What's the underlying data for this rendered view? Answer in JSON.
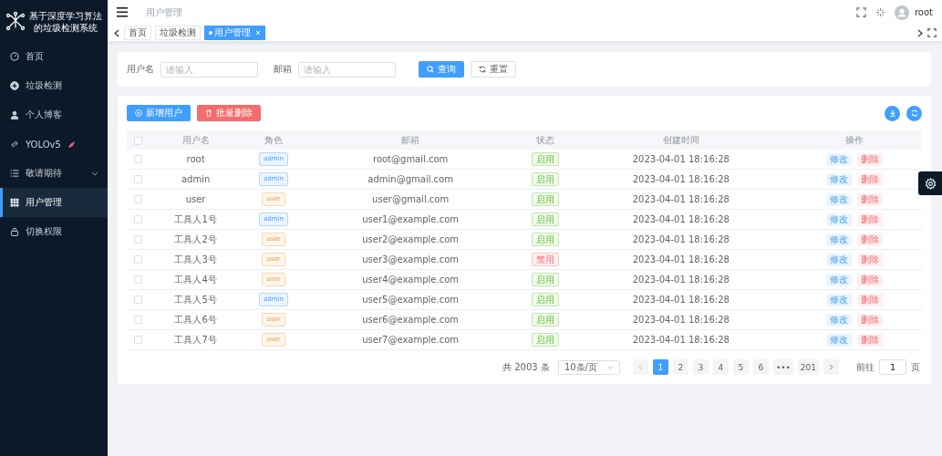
{
  "sidebar": {
    "title_lines": [
      "基于深度学习算法",
      "的垃圾检测系统"
    ],
    "items": [
      {
        "label": "首页",
        "selected": false
      },
      {
        "label": "垃圾检测",
        "selected": false
      },
      {
        "label": "个人博客",
        "selected": false
      },
      {
        "label": "YOLOv5",
        "selected": false
      },
      {
        "label": "敬请期待",
        "selected": false,
        "expanded": false
      },
      {
        "label": "用户管理",
        "selected": true
      },
      {
        "label": "切换权限",
        "selected": false
      }
    ]
  },
  "header": {
    "breadcrumb": "用户管理",
    "user": "root"
  },
  "tabs": [
    {
      "label": "首页",
      "selected": false,
      "closable": false
    },
    {
      "label": "垃圾检测",
      "selected": false,
      "closable": false
    },
    {
      "label": "用户管理",
      "selected": true,
      "closable": true
    }
  ],
  "search": {
    "fields": [
      {
        "label": "用户名",
        "placeholder": "请输入"
      },
      {
        "label": "邮箱",
        "placeholder": "请输入"
      }
    ],
    "query_button": "查询",
    "reset_button": "重置"
  },
  "toolbar": {
    "add_button": "新增用户",
    "batch_delete_button": "批量删除"
  },
  "table": {
    "select_all_checked": false,
    "columns": [
      "用户名",
      "角色",
      "邮箱",
      "状态",
      "创建时间",
      "操作"
    ],
    "rows": [
      {
        "username": "root",
        "role": {
          "label": "admin",
          "kind": "primary"
        },
        "email": "root@gmail.com",
        "status": {
          "label": "启用",
          "enabled": true
        },
        "created": "2023-04-01 18:16:28",
        "edit": "修改",
        "delete": "删除",
        "checked": false
      },
      {
        "username": "admin",
        "role": {
          "label": "admin",
          "kind": "primary"
        },
        "email": "admin@gmail.com",
        "status": {
          "label": "启用",
          "enabled": true
        },
        "created": "2023-04-01 18:16:28",
        "edit": "修改",
        "delete": "删除",
        "checked": false
      },
      {
        "username": "user",
        "role": {
          "label": "user",
          "kind": "warning"
        },
        "email": "user@gmail.com",
        "status": {
          "label": "启用",
          "enabled": true
        },
        "created": "2023-04-01 18:16:28",
        "edit": "修改",
        "delete": "删除",
        "checked": false
      },
      {
        "username": "工具人1号",
        "role": {
          "label": "admin",
          "kind": "primary"
        },
        "email": "user1@example.com",
        "status": {
          "label": "启用",
          "enabled": true
        },
        "created": "2023-04-01 18:16:28",
        "edit": "修改",
        "delete": "删除",
        "checked": false
      },
      {
        "username": "工具人2号",
        "role": {
          "label": "user",
          "kind": "warning"
        },
        "email": "user2@example.com",
        "status": {
          "label": "启用",
          "enabled": true
        },
        "created": "2023-04-01 18:16:28",
        "edit": "修改",
        "delete": "删除",
        "checked": false
      },
      {
        "username": "工具人3号",
        "role": {
          "label": "user",
          "kind": "warning"
        },
        "email": "user3@example.com",
        "status": {
          "label": "禁用",
          "enabled": false
        },
        "created": "2023-04-01 18:16:28",
        "edit": "修改",
        "delete": "删除",
        "checked": false
      },
      {
        "username": "工具人4号",
        "role": {
          "label": "user",
          "kind": "warning"
        },
        "email": "user4@example.com",
        "status": {
          "label": "启用",
          "enabled": true
        },
        "created": "2023-04-01 18:16:28",
        "edit": "修改",
        "delete": "删除",
        "checked": false
      },
      {
        "username": "工具人5号",
        "role": {
          "label": "admin",
          "kind": "primary"
        },
        "email": "user5@example.com",
        "status": {
          "label": "启用",
          "enabled": true
        },
        "created": "2023-04-01 18:16:28",
        "edit": "修改",
        "delete": "删除",
        "checked": false
      },
      {
        "username": "工具人6号",
        "role": {
          "label": "user",
          "kind": "warning"
        },
        "email": "user6@example.com",
        "status": {
          "label": "启用",
          "enabled": true
        },
        "created": "2023-04-01 18:16:28",
        "edit": "修改",
        "delete": "删除",
        "checked": false
      },
      {
        "username": "工具人7号",
        "role": {
          "label": "user",
          "kind": "warning"
        },
        "email": "user7@example.com",
        "status": {
          "label": "启用",
          "enabled": true
        },
        "created": "2023-04-01 18:16:28",
        "edit": "修改",
        "delete": "删除",
        "checked": false
      }
    ]
  },
  "pagination": {
    "total": "共 2003 条",
    "page_size": "10条/页",
    "pages": [
      {
        "label": "1",
        "selected": true
      },
      {
        "label": "2",
        "selected": false
      },
      {
        "label": "3",
        "selected": false
      },
      {
        "label": "4",
        "selected": false
      },
      {
        "label": "5",
        "selected": false
      },
      {
        "label": "6",
        "selected": false
      },
      {
        "label": "•••",
        "selected": false
      },
      {
        "label": "201",
        "selected": false
      }
    ],
    "goto_label": "前往",
    "goto_value": "1",
    "page_suffix": "页"
  }
}
